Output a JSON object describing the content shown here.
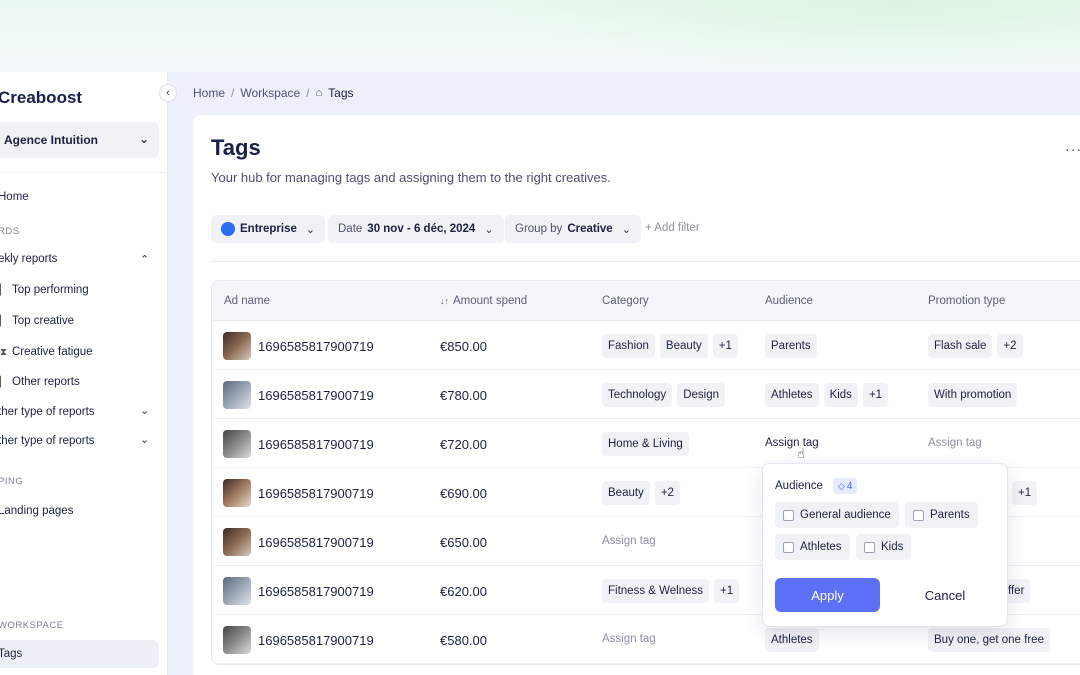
{
  "sidebar": {
    "brand": "Creaboost",
    "workspace": "Agence Intuition",
    "collapse_icon": "‹",
    "home": "Home",
    "section_boards": "RDS",
    "weekly_reports": "ekly reports",
    "sub_items": [
      "Top performing",
      "Top creative",
      "Creative fatigue",
      "Other reports"
    ],
    "other_type_1": "ther type of reports",
    "other_type_2": "ther type of reports",
    "section_mapping": "PING",
    "landing_pages": "Landing pages",
    "section_workspace": "WORKSPACE",
    "tags": "Tags"
  },
  "breadcrumb": {
    "home": "Home",
    "workspace": "Workspace",
    "current": "Tags"
  },
  "page": {
    "title": "Tags",
    "subtitle": "Your hub for managing tags and assigning them to the right creatives.",
    "more": "···"
  },
  "filters": {
    "account": "Entreprise",
    "date_label": "Date",
    "date_value": "30 nov - 6 déc, 2024",
    "group_label": "Group by",
    "group_value": "Creative",
    "add_filter": "+ Add filter"
  },
  "table": {
    "headers": [
      "Ad name",
      "Amount spend",
      "Category",
      "Audience",
      "Promotion type"
    ],
    "sort_icon": "↓↑",
    "rows": [
      {
        "name": "1696585817900719",
        "amount": "€850.00",
        "category": [
          "Fashion",
          "Beauty",
          "+1"
        ],
        "audience": [
          "Parents"
        ],
        "promotion": [
          "Flash sale",
          "+2"
        ]
      },
      {
        "name": "1696585817900719",
        "amount": "€780.00",
        "category": [
          "Technology",
          "Design"
        ],
        "audience": [
          "Athletes",
          "Kids",
          "+1"
        ],
        "promotion": [
          "With promotion"
        ]
      },
      {
        "name": "1696585817900719",
        "amount": "€720.00",
        "category": [
          "Home & Living"
        ],
        "audience_assign": "Assign tag",
        "promotion_assign": "Assign tag"
      },
      {
        "name": "1696585817900719",
        "amount": "€690.00",
        "category": [
          "Beauty",
          "+2"
        ],
        "promotion": [
          "+1"
        ]
      },
      {
        "name": "1696585817900719",
        "amount": "€650.00",
        "category_assign": "Assign tag"
      },
      {
        "name": "1696585817900719",
        "amount": "€620.00",
        "category": [
          "Fitness & Welness",
          "+1"
        ],
        "promotion_partial": "ffer"
      },
      {
        "name": "1696585817900719",
        "amount": "€580.00",
        "category_assign": "Assign tag",
        "audience": [
          "Athletes"
        ],
        "promotion": [
          "Buy one, get one free"
        ]
      }
    ]
  },
  "popover": {
    "title": "Audience",
    "count": "4",
    "options": [
      "General audience",
      "Parents",
      "Athletes",
      "Kids"
    ],
    "apply": "Apply",
    "cancel": "Cancel"
  },
  "colors": {
    "accent": "#5b70f5",
    "brand_dot": "#2d6cf3"
  }
}
